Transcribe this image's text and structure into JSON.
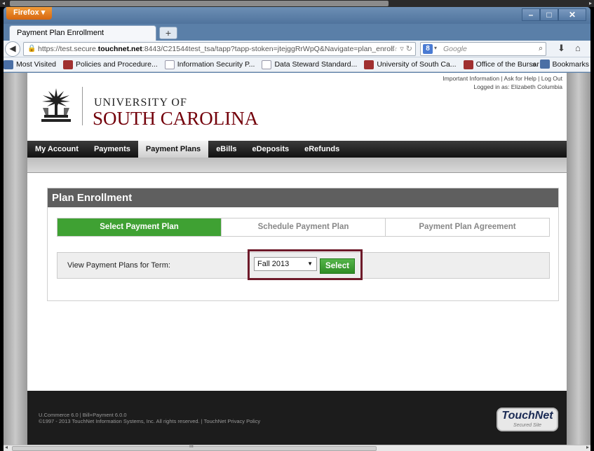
{
  "browser": {
    "menu_label": "Firefox ▾",
    "tab_title": "Payment Plan Enrollment",
    "new_tab": "+",
    "url_prefix": "https://test.secure.",
    "url_domain": "touchnet.net",
    "url_suffix": ":8443/C21544test_tsa/tapp?tapp-stoken=jtejggRrWpQ&Navigate=plan_enroll",
    "search_placeholder": "Google",
    "bookmarks": [
      {
        "label": "Most Visited",
        "icon": "blue"
      },
      {
        "label": "Policies and Procedure...",
        "icon": "red"
      },
      {
        "label": "Information Security P...",
        "icon": "blank"
      },
      {
        "label": "Data Steward Standard...",
        "icon": "blank"
      },
      {
        "label": "University of South Ca...",
        "icon": "red"
      },
      {
        "label": "Office of the Bursar",
        "icon": "red"
      }
    ],
    "bookmarks_menu": "Bookmarks",
    "bookmarks_overflow": "»"
  },
  "header": {
    "university_of": "UNIVERSITY OF",
    "south_carolina": "SOUTH CAROLINA",
    "top_links": "Important Information | Ask for Help | Log Out",
    "logged_in": "Logged in as: Elizabeth Columbia"
  },
  "nav": {
    "items": [
      "My Account",
      "Payments",
      "Payment Plans",
      "eBills",
      "eDeposits",
      "eRefunds"
    ],
    "active": "Payment Plans"
  },
  "enrollment": {
    "title": "Plan Enrollment",
    "steps": [
      "Select Payment Plan",
      "Schedule Payment Plan",
      "Payment Plan Agreement"
    ],
    "term_label": "View Payment Plans for Term:",
    "term_value": "Fall 2013",
    "select_button": "Select"
  },
  "footer": {
    "line1": "U.Commerce 6.0 | Bill+Payment 6.0.0",
    "line2": "©1997 - 2013 TouchNet Information Systems, Inc. All rights reserved. | TouchNet Privacy Policy",
    "logo": "TouchNet",
    "logo_sub": "Secured Site"
  },
  "colors": {
    "brand_garnet": "#73000a",
    "step_active": "#3fa133",
    "highlight_border": "#6e1a2a"
  }
}
